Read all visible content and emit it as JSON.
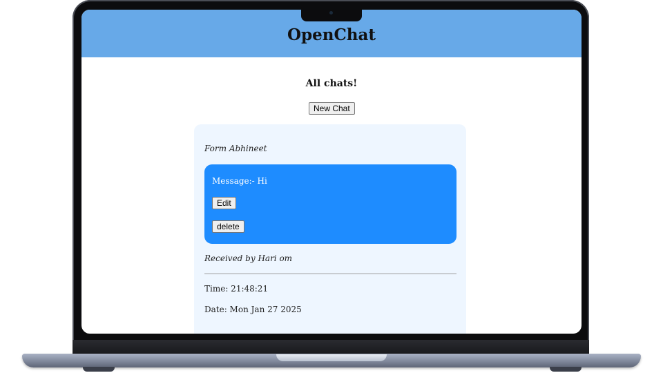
{
  "app": {
    "title": "OpenChat",
    "header_color": "#67a9e8"
  },
  "page": {
    "heading": "All chats!",
    "new_chat_label": "New Chat"
  },
  "chats": [
    {
      "from_text": "Form Abhineet",
      "message_text": "Message:- Hi",
      "edit_label": "Edit",
      "delete_label": "delete",
      "received_text": "Received by Hari om",
      "time_text": "Time: 21:48:21",
      "date_text": "Date: Mon Jan 27 2025",
      "card_color": "#eef6ff",
      "message_color": "#1e8cff"
    }
  ]
}
